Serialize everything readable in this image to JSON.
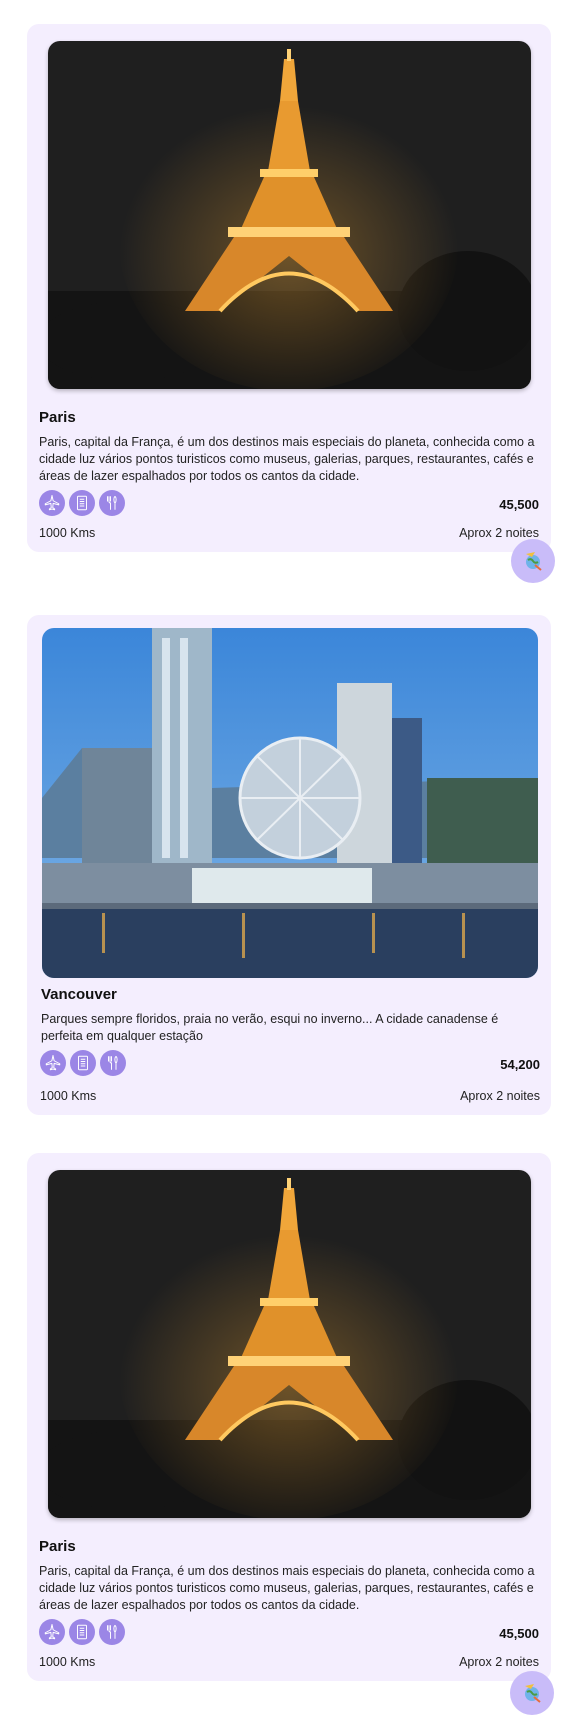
{
  "cards": [
    {
      "title": "Paris",
      "description": "Paris, capital da França, é um dos destinos mais especiais do planeta, conhecida como a cidade luz vários pontos turisticos como museus, galerias, parques, restaurantes, cafés e áreas de lazer espalhados por todos os cantos da cidade.",
      "price": "45,500",
      "distance": "1000 Kms",
      "duration": "Aprox 2 noites",
      "amenities": [
        "airplane-icon",
        "hotel-icon",
        "food-icon"
      ]
    },
    {
      "title": "Vancouver",
      "description": "Parques sempre floridos, praia no verão, esqui no inverno... A cidade canadense é perfeita em qualquer estação",
      "price": "54,200",
      "distance": "1000 Kms",
      "duration": "Aprox 2 noites",
      "amenities": [
        "airplane-icon",
        "hotel-icon",
        "food-icon"
      ]
    },
    {
      "title": "Paris",
      "description": "Paris, capital da França, é um dos destinos mais especiais do planeta, conhecida como a cidade luz vários pontos turisticos como museus, galerias, parques, restaurantes, cafés e áreas de lazer espalhados por todos os cantos da cidade.",
      "price": "45,500",
      "distance": "1000 Kms",
      "duration": "Aprox 2 noites",
      "amenities": [
        "airplane-icon",
        "hotel-icon",
        "food-icon"
      ]
    }
  ],
  "fab_icon": "travel-icon",
  "colors": {
    "card_background": "#f4eefe",
    "amenity_icon_bg": "#9b86e6",
    "fab_bg": "#c9bcf9"
  }
}
